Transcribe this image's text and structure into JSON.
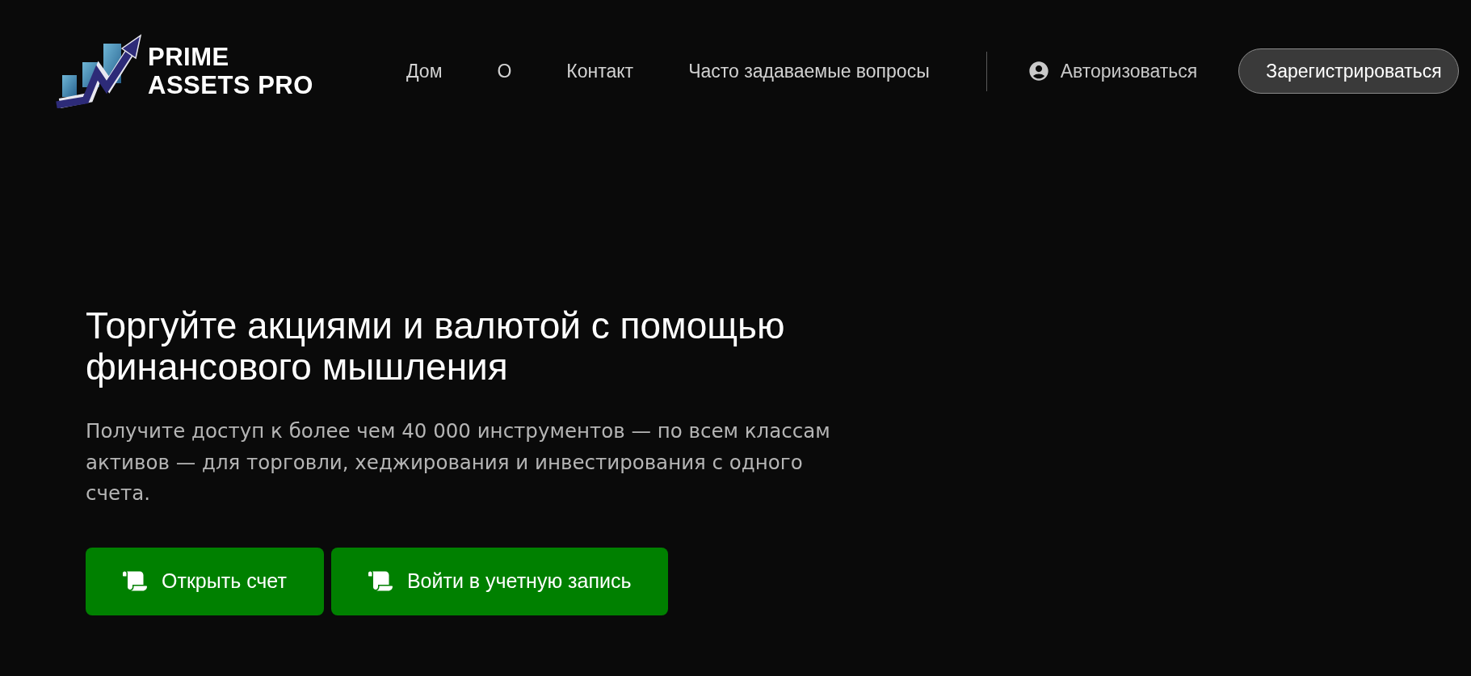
{
  "header": {
    "brand": {
      "lines": [
        "PRIME",
        "ASSETS PRO"
      ]
    },
    "nav": [
      {
        "label": "Дом"
      },
      {
        "label": "О"
      },
      {
        "label": "Контакт"
      },
      {
        "label": "Часто задаваемые вопросы"
      }
    ],
    "login": {
      "label": "Авторизоваться"
    },
    "register_button": {
      "label": "Зарегистрироваться"
    }
  },
  "hero": {
    "title": "Торгуйте акциями и валютой с помощью финансового мышления",
    "text": "Получите доступ к более чем 40 000 инструментов — по всем классам активов — для торговли, хеджирования и инвестирования с одного счета.",
    "buttons": [
      {
        "label": "Открыть счет"
      },
      {
        "label": "Войти в учетную запись"
      }
    ]
  }
}
